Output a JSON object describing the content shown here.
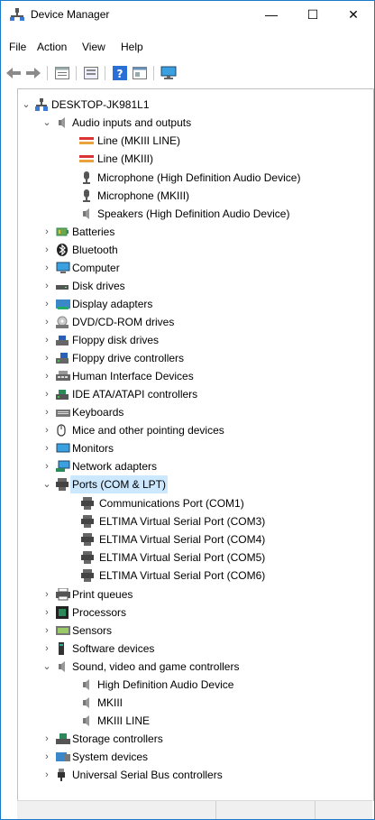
{
  "window": {
    "title": "Device Manager",
    "minimize": "—",
    "maximize": "☐",
    "close": "✕"
  },
  "menu": {
    "file": "File",
    "action": "Action",
    "view": "View",
    "help": "Help"
  },
  "toolbar": {
    "buttons": [
      "back-icon",
      "forward-icon",
      "properties-icon",
      "update-driver-icon",
      "help-icon",
      "show-hidden-icon",
      "monitor-icon"
    ]
  },
  "tree": {
    "root": "DESKTOP-JK981L1",
    "audio": "Audio inputs and outputs",
    "audio_children": [
      "Line (MKIII LINE)",
      "Line (MKIII)",
      "Microphone (High Definition Audio Device)",
      "Microphone (MKIII)",
      "Speakers (High Definition Audio Device)"
    ],
    "batteries": "Batteries",
    "bluetooth": "Bluetooth",
    "computer": "Computer",
    "disk": "Disk drives",
    "display": "Display adapters",
    "dvd": "DVD/CD-ROM drives",
    "floppy_disk": "Floppy disk drives",
    "floppy_ctrl": "Floppy drive controllers",
    "hid": "Human Interface Devices",
    "ide": "IDE ATA/ATAPI controllers",
    "keyboards": "Keyboards",
    "mice": "Mice and other pointing devices",
    "monitors": "Monitors",
    "network": "Network adapters",
    "ports": "Ports (COM & LPT)",
    "ports_children": [
      "Communications Port (COM1)",
      "ELTIMA Virtual Serial Port (COM3)",
      "ELTIMA Virtual Serial Port (COM4)",
      "ELTIMA Virtual Serial Port (COM5)",
      "ELTIMA Virtual Serial Port (COM6)"
    ],
    "print": "Print queues",
    "processors": "Processors",
    "sensors": "Sensors",
    "software": "Software devices",
    "sound": "Sound, video and game controllers",
    "sound_children": [
      "High Definition Audio Device",
      "MKIII",
      "MKIII LINE"
    ],
    "storage": "Storage controllers",
    "system": "System devices",
    "usb": "Universal Serial Bus controllers"
  }
}
